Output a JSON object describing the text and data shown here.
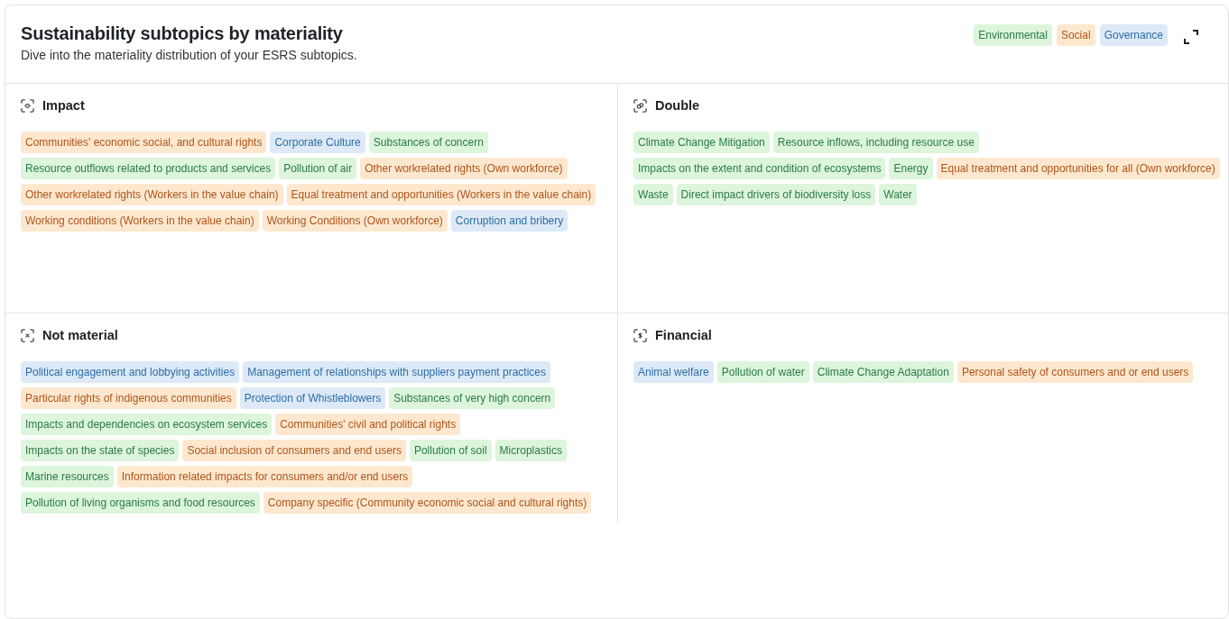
{
  "card": {
    "title": "Sustainability subtopics by materiality",
    "subtitle": "Dive into the materiality distribution of your ESRS subtopics.",
    "legend": [
      {
        "label": "Environmental",
        "kind": "environmental"
      },
      {
        "label": "Social",
        "kind": "social"
      },
      {
        "label": "Governance",
        "kind": "governance"
      }
    ]
  },
  "quadrants": [
    {
      "title": "Impact",
      "kind": "impact",
      "tags": [
        {
          "label": "Communities' economic social, and cultural rights",
          "kind": "social"
        },
        {
          "label": "Corporate Culture",
          "kind": "governance"
        },
        {
          "label": "Substances of concern",
          "kind": "environmental"
        },
        {
          "label": "Resource outflows related to products and services",
          "kind": "environmental"
        },
        {
          "label": "Pollution of air",
          "kind": "environmental"
        },
        {
          "label": "Other workrelated rights (Own workforce)",
          "kind": "social"
        },
        {
          "label": "Other workrelated rights (Workers in the value chain)",
          "kind": "social"
        },
        {
          "label": "Equal treatment and opportunities (Workers in the value chain)",
          "kind": "social"
        },
        {
          "label": "Working conditions (Workers in the value chain)",
          "kind": "social"
        },
        {
          "label": "Working Conditions (Own workforce)",
          "kind": "social"
        },
        {
          "label": "Corruption and bribery",
          "kind": "governance"
        }
      ]
    },
    {
      "title": "Double",
      "kind": "double",
      "tags": [
        {
          "label": "Climate Change Mitigation",
          "kind": "environmental"
        },
        {
          "label": "Resource inflows, including resource use",
          "kind": "environmental"
        },
        {
          "label": "Impacts on the extent and condition of ecosystems",
          "kind": "environmental"
        },
        {
          "label": "Energy",
          "kind": "environmental"
        },
        {
          "label": "Equal treatment and opportunities for all (Own workforce)",
          "kind": "social"
        },
        {
          "label": "Waste",
          "kind": "environmental"
        },
        {
          "label": "Direct impact drivers of biodiversity loss",
          "kind": "environmental"
        },
        {
          "label": "Water",
          "kind": "environmental"
        }
      ]
    },
    {
      "title": "Not material",
      "kind": "not_material",
      "tags": [
        {
          "label": "Political engagement and lobbying activities",
          "kind": "governance"
        },
        {
          "label": "Management of relationships with suppliers payment practices",
          "kind": "governance"
        },
        {
          "label": "Particular rights of indigenous communities",
          "kind": "social"
        },
        {
          "label": "Protection of Whistleblowers",
          "kind": "governance"
        },
        {
          "label": "Substances of very high concern",
          "kind": "environmental"
        },
        {
          "label": "Impacts and dependencies on ecosystem services",
          "kind": "environmental"
        },
        {
          "label": "Communities' civil and political rights",
          "kind": "social"
        },
        {
          "label": "Impacts on the state of species",
          "kind": "environmental"
        },
        {
          "label": "Social inclusion of consumers and end users",
          "kind": "social"
        },
        {
          "label": "Pollution of soil",
          "kind": "environmental"
        },
        {
          "label": "Microplastics",
          "kind": "environmental"
        },
        {
          "label": "Marine resources",
          "kind": "environmental"
        },
        {
          "label": "Information related impacts for consumers and/or end users",
          "kind": "social"
        },
        {
          "label": "Pollution of living organisms and food resources",
          "kind": "environmental"
        },
        {
          "label": "Company specific (Community economic social and cultural rights)",
          "kind": "social"
        }
      ]
    },
    {
      "title": "Financial",
      "kind": "financial",
      "tags": [
        {
          "label": "Animal welfare",
          "kind": "governance"
        },
        {
          "label": "Pollution of water",
          "kind": "environmental"
        },
        {
          "label": "Climate Change Adaptation",
          "kind": "environmental"
        },
        {
          "label": "Personal safety of consumers and or end users",
          "kind": "social"
        }
      ]
    }
  ]
}
